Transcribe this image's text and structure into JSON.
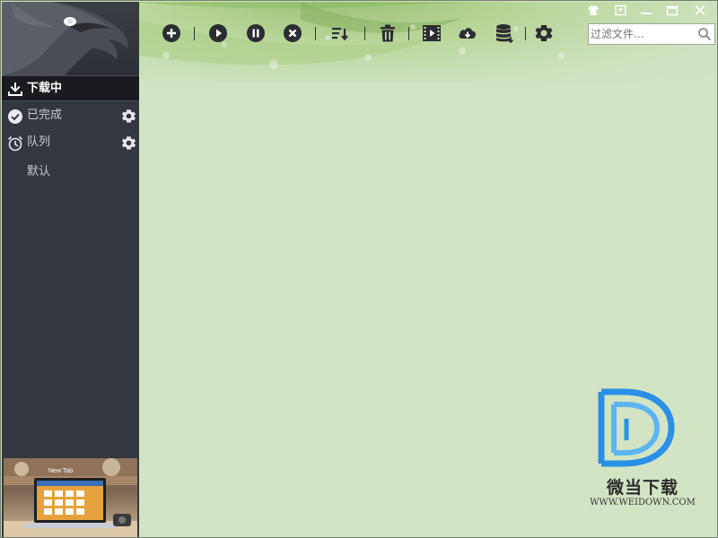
{
  "sidebar": {
    "items": [
      {
        "label": "下载中",
        "icon": "download-tray-icon",
        "active": true
      },
      {
        "label": "已完成",
        "icon": "check-circle-icon",
        "active": false,
        "has_settings": true
      },
      {
        "label": "队列",
        "icon": "alarm-clock-icon",
        "active": false,
        "has_settings": true
      }
    ],
    "queue_default": "默认",
    "ad": {
      "caption": "New Tab"
    }
  },
  "toolbar": {
    "buttons": [
      {
        "name": "add",
        "icon": "plus-circle-icon"
      },
      {
        "name": "resume",
        "icon": "play-circle-icon"
      },
      {
        "name": "pause",
        "icon": "pause-circle-icon"
      },
      {
        "name": "stop",
        "icon": "x-circle-icon"
      },
      {
        "name": "sort",
        "icon": "sort-list-icon"
      },
      {
        "name": "delete",
        "icon": "trash-icon"
      },
      {
        "name": "video",
        "icon": "film-icon"
      },
      {
        "name": "cloud",
        "icon": "cloud-download-icon"
      },
      {
        "name": "database",
        "icon": "database-icon"
      },
      {
        "name": "settings",
        "icon": "gear-icon"
      }
    ]
  },
  "search": {
    "placeholder": "过滤文件...",
    "value": ""
  },
  "window_controls": [
    "skin-shirt-icon",
    "dropdown-icon",
    "minimize-icon",
    "maximize-icon",
    "close-icon"
  ],
  "watermark": {
    "brand": "微当下载",
    "url": "WWW.WEIDOWN.COM"
  },
  "colors": {
    "sidebar_bg": "#333740",
    "active_item_bg": "#1a1b1e",
    "main_bg": "#d2e4c3",
    "watermark_blue": "#2a8fe6",
    "icon_dark": "#2b2d30"
  }
}
